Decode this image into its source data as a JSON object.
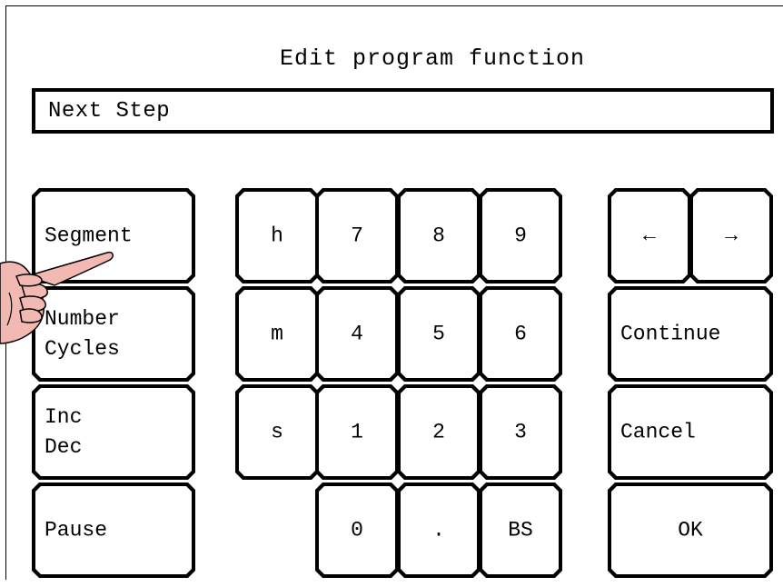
{
  "title": "Edit program function",
  "display": {
    "value": "Next Step"
  },
  "function_keys": [
    {
      "label": "Segment"
    },
    {
      "label": "Number\nCycles"
    },
    {
      "label": "Inc\nDec"
    },
    {
      "label": "Pause"
    }
  ],
  "keypad": {
    "units": [
      {
        "label": "h"
      },
      {
        "label": "m"
      },
      {
        "label": "s"
      }
    ],
    "digits_row1": [
      {
        "label": "7"
      },
      {
        "label": "8"
      },
      {
        "label": "9"
      }
    ],
    "digits_row2": [
      {
        "label": "4"
      },
      {
        "label": "5"
      },
      {
        "label": "6"
      }
    ],
    "digits_row3": [
      {
        "label": "1"
      },
      {
        "label": "2"
      },
      {
        "label": "3"
      }
    ],
    "digits_row4": [
      {
        "label": "0"
      },
      {
        "label": "."
      },
      {
        "label": "BS"
      }
    ]
  },
  "actions": {
    "left_arrow": "←",
    "right_arrow": "→",
    "continue": "Continue",
    "cancel": "Cancel",
    "ok": "OK"
  },
  "pointer_icon": "pointing-hand-icon"
}
